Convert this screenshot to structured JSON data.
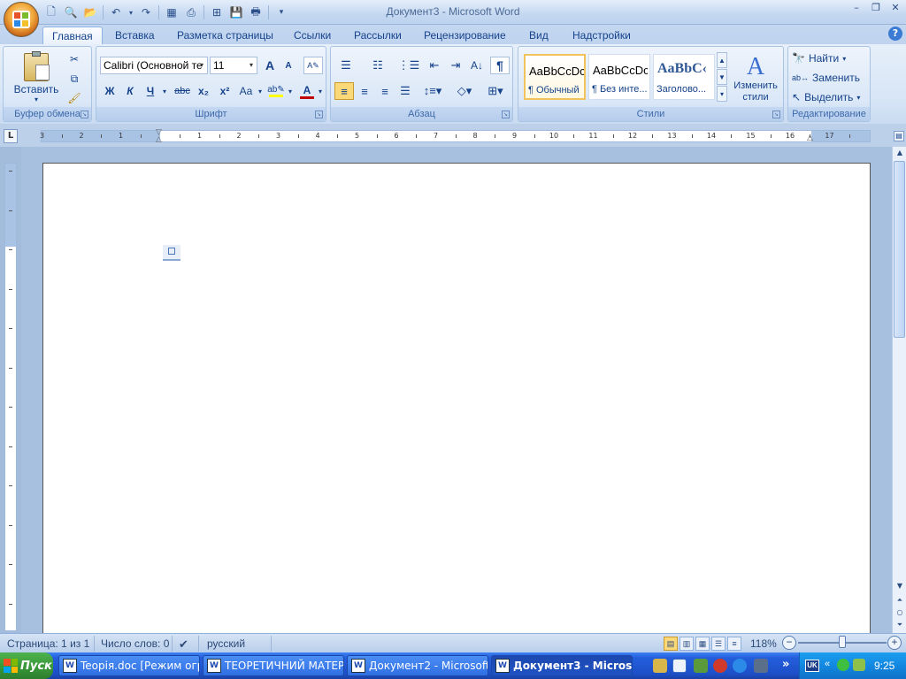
{
  "window": {
    "title": "Документ3 - Microsoft Word",
    "minimize": "–",
    "restore": "❐",
    "close": "✕"
  },
  "tabs": [
    "Главная",
    "Вставка",
    "Разметка страницы",
    "Ссылки",
    "Рассылки",
    "Рецензирование",
    "Вид",
    "Надстройки"
  ],
  "help_label": "?",
  "groups": {
    "clipboard": {
      "label": "Буфер обмена",
      "paste": "Вставить"
    },
    "font": {
      "label": "Шрифт",
      "font_name": "Calibri (Основной те",
      "font_size": "11",
      "bold": "Ж",
      "italic": "К",
      "underline": "Ч",
      "strike": "abc",
      "subscript": "x₂",
      "superscript": "x²",
      "case": "Aa",
      "grow": "A",
      "shrink": "A"
    },
    "paragraph": {
      "label": "Абзац",
      "pilcrow": "¶"
    },
    "styles": {
      "label": "Стили",
      "items": [
        {
          "preview": "AaBbCcDc",
          "name": "¶ Обычный"
        },
        {
          "preview": "AaBbCcDc",
          "name": "¶ Без инте..."
        },
        {
          "preview": "AaBbC‹",
          "name": "Заголово..."
        }
      ],
      "change": "Изменить стили"
    },
    "editing": {
      "label": "Редактирование",
      "find": "Найти",
      "replace": "Заменить",
      "select": "Выделить"
    }
  },
  "ruler": {
    "tab_marker": "L",
    "ticks": [
      "3",
      "2",
      "1",
      "1",
      "2",
      "3",
      "4",
      "5",
      "6",
      "7",
      "8",
      "9",
      "10",
      "11",
      "12",
      "13",
      "14",
      "15",
      "16",
      "17"
    ]
  },
  "status": {
    "page": "Страница: 1 из 1",
    "words": "Число слов: 0",
    "language": "русский",
    "zoom": "118%",
    "zoom_out": "−",
    "zoom_in": "+"
  },
  "taskbar": {
    "start": "Пуск",
    "items": [
      "Teopiя.doc [Режим огра...",
      "ТЕОРЕТИЧНИЙ МАТЕРІА...",
      "Документ2 - Microsoft ...",
      "Документ3 - Microso..."
    ],
    "lang": "UK",
    "clock": "9:25",
    "more": "»"
  }
}
